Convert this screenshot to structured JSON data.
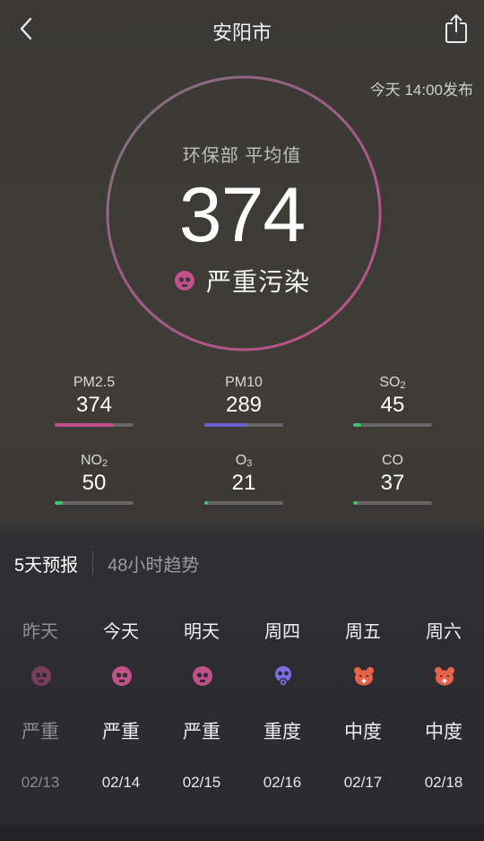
{
  "header": {
    "title": "安阳市",
    "back_icon": "chevron-left-icon",
    "share_icon": "share-icon"
  },
  "publish_time": "今天 14:00发布",
  "aqi": {
    "source_label": "环保部 平均值",
    "value": "374",
    "level": "严重污染",
    "level_icon": "skull-icon",
    "level_color": "#c2508a"
  },
  "pollutants": [
    {
      "name": "PM2.5",
      "sub": "",
      "value": "374",
      "level_fraction": 0.75,
      "color": "#c2508a"
    },
    {
      "name": "PM10",
      "sub": "",
      "value": "289",
      "level_fraction": 0.55,
      "color": "#6b5fd0"
    },
    {
      "name": "SO",
      "sub": "2",
      "value": "45",
      "level_fraction": 0.1,
      "color": "#3cc46a"
    },
    {
      "name": "NO",
      "sub": "2",
      "value": "50",
      "level_fraction": 0.1,
      "color": "#3cc46a"
    },
    {
      "name": "O",
      "sub": "3",
      "value": "21",
      "level_fraction": 0.05,
      "color": "#3cc46a"
    },
    {
      "name": "CO",
      "sub": "",
      "value": "37",
      "level_fraction": 0.06,
      "color": "#3cc46a"
    }
  ],
  "tabs": {
    "active": "5天预报",
    "inactive": "48小时趋势"
  },
  "forecast": [
    {
      "day": "昨天",
      "level": "严重",
      "date": "02/13",
      "icon": "skull-icon",
      "color": "#c2508a"
    },
    {
      "day": "今天",
      "level": "严重",
      "date": "02/14",
      "icon": "skull-icon",
      "color": "#c2508a"
    },
    {
      "day": "明天",
      "level": "严重",
      "date": "02/15",
      "icon": "skull-icon",
      "color": "#c2508a"
    },
    {
      "day": "周四",
      "level": "重度",
      "date": "02/16",
      "icon": "gas-mask-icon",
      "color": "#7b6ee8"
    },
    {
      "day": "周五",
      "level": "中度",
      "date": "02/17",
      "icon": "sick-face-icon",
      "color": "#e8624a"
    },
    {
      "day": "周六",
      "level": "中度",
      "date": "02/18",
      "icon": "sick-face-icon",
      "color": "#e8624a"
    }
  ]
}
